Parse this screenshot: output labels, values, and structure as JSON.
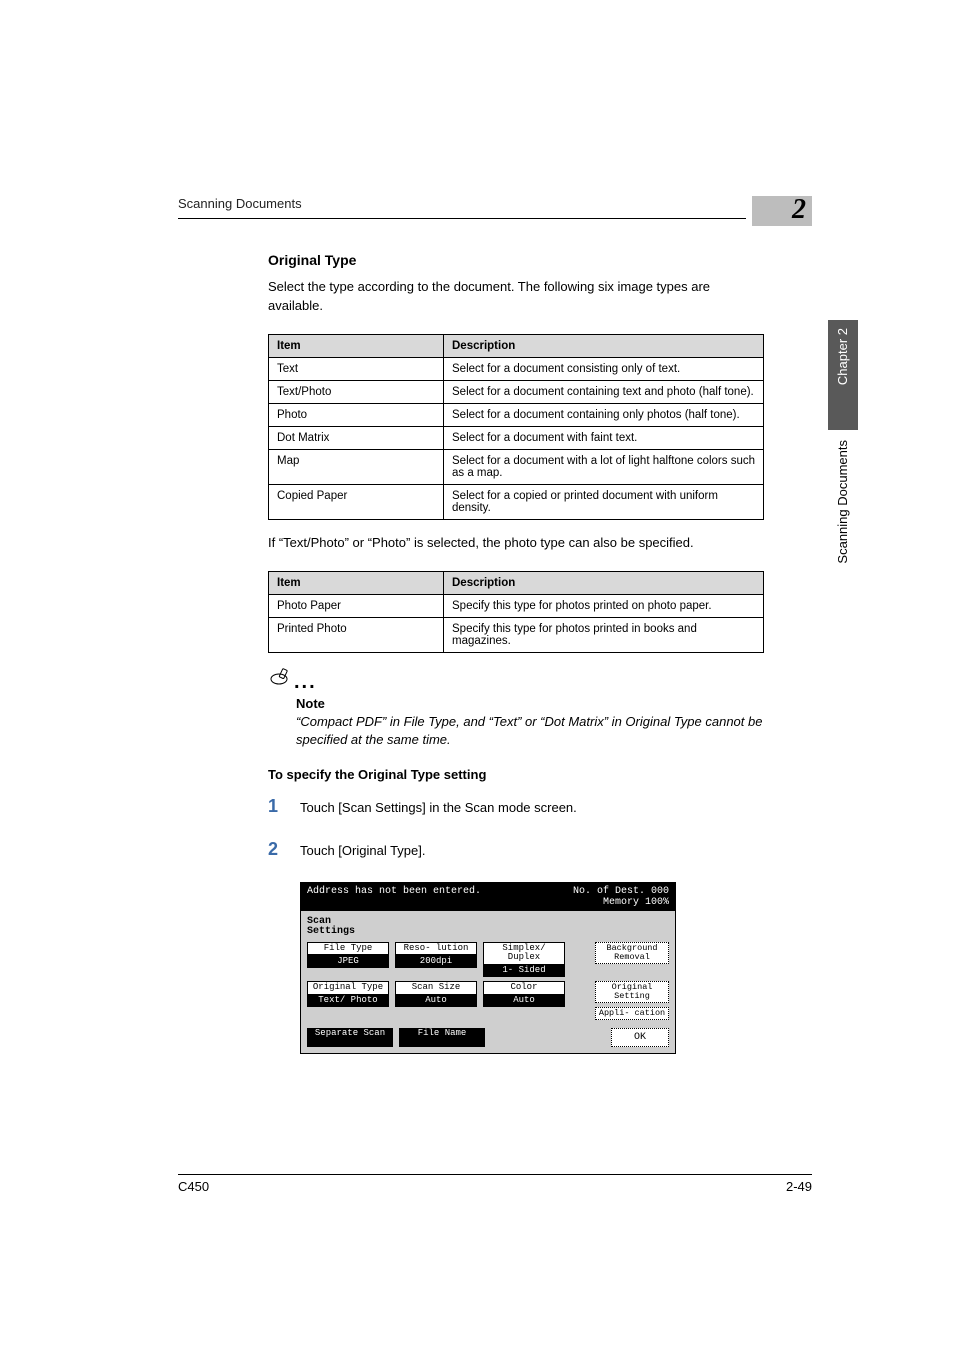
{
  "running_header": "Scanning Documents",
  "chapter_number_badge": "2",
  "side_tab_dark": "Chapter 2",
  "side_tab_light": "Scanning Documents",
  "section_title": "Original Type",
  "intro_paragraph": "Select the type according to the document. The following six image types are available.",
  "table1": {
    "head_item": "Item",
    "head_desc": "Description",
    "rows": [
      {
        "item": "Text",
        "desc": "Select for a document consisting only of text."
      },
      {
        "item": "Text/Photo",
        "desc": "Select for a document containing text and photo (half tone)."
      },
      {
        "item": "Photo",
        "desc": "Select for a document containing only photos (half tone)."
      },
      {
        "item": "Dot Matrix",
        "desc": "Select for a document with faint text."
      },
      {
        "item": "Map",
        "desc": "Select for a document with a lot of light halftone colors such as a map."
      },
      {
        "item": "Copied Paper",
        "desc": "Select for a copied or printed document with uniform density."
      }
    ]
  },
  "after_table1": "If “Text/Photo” or “Photo” is selected, the photo type can also be specified.",
  "table2": {
    "head_item": "Item",
    "head_desc": "Description",
    "rows": [
      {
        "item": "Photo Paper",
        "desc": "Specify this type for photos printed on photo paper."
      },
      {
        "item": "Printed Photo",
        "desc": "Specify this type for photos printed in books and magazines."
      }
    ]
  },
  "note": {
    "label": "Note",
    "text": "“Compact PDF” in File Type, and “Text” or “Dot Matrix” in Original Type cannot be specified at the same time."
  },
  "procedure_title": "To specify the Original Type setting",
  "steps": [
    {
      "num": "1",
      "text": "Touch [Scan Settings] in the Scan mode screen."
    },
    {
      "num": "2",
      "text": "Touch [Original Type]."
    }
  ],
  "lcd": {
    "top_left": "Address has not been entered.",
    "top_right_line1": "No. of Dest.   000",
    "top_right_line2": "Memory 100%",
    "tab_label_line1": "Scan",
    "tab_label_line2": "Settings",
    "grid": [
      [
        {
          "top": "File Type",
          "bot": "JPEG"
        },
        {
          "top": "Reso- lution",
          "bot": "200dpi"
        },
        {
          "top": "Simplex/ Duplex",
          "bot": "1- Sided"
        }
      ],
      [
        {
          "top": "Original Type",
          "bot": "Text/ Photo"
        },
        {
          "top": "Scan Size",
          "bot": "Auto"
        },
        {
          "top": "Color",
          "bot": "Auto"
        }
      ]
    ],
    "side_buttons": [
      "Background Removal",
      "Original Setting",
      "Appli- cation"
    ],
    "bottom_row": [
      "Separate Scan",
      "File Name"
    ],
    "ok_label": "OK"
  },
  "footer_left": "C450",
  "footer_right": "2-49"
}
